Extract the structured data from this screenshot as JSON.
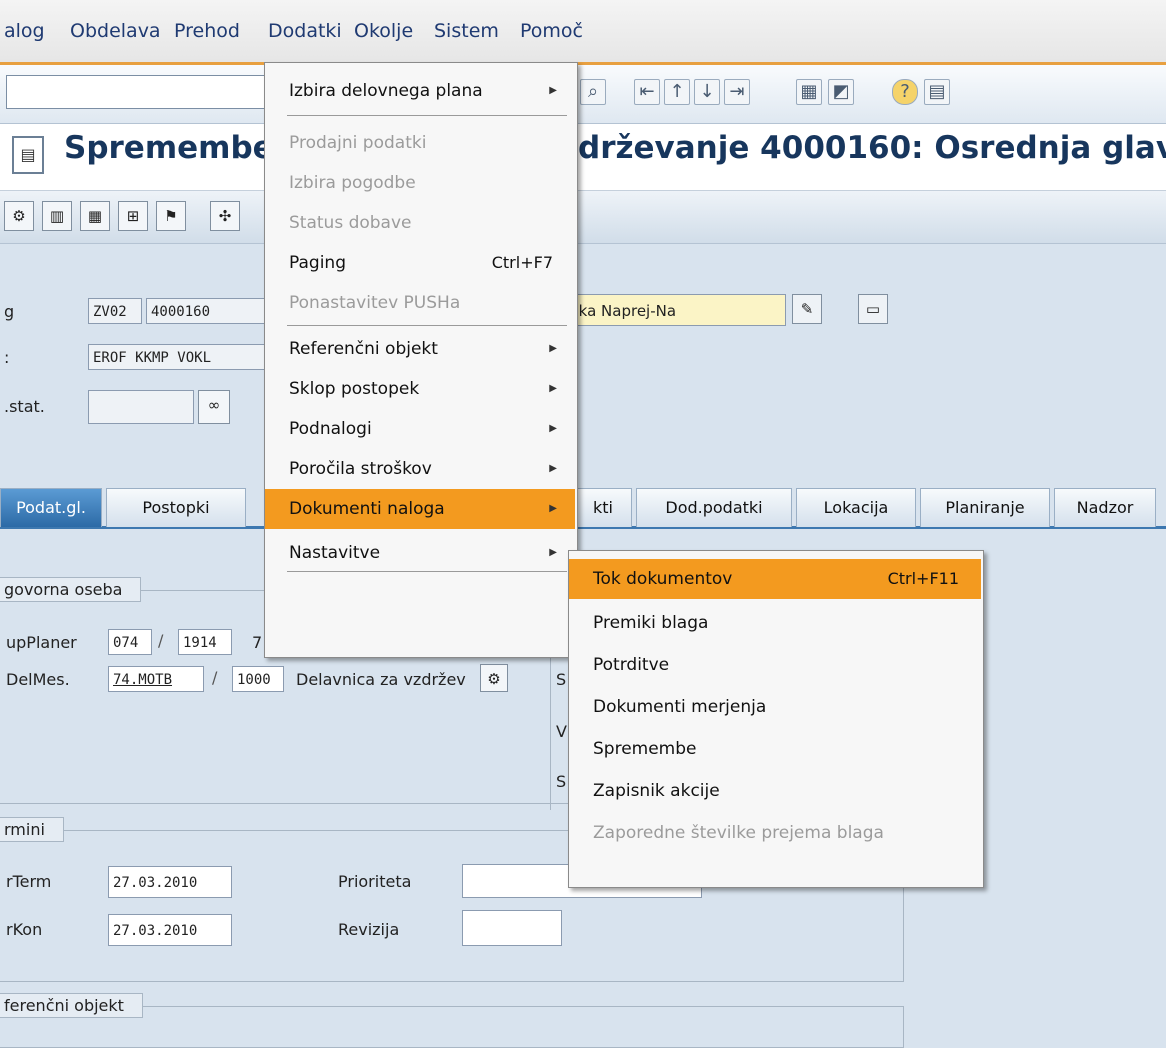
{
  "menubar": {
    "items": [
      "alog",
      "Obdelava",
      "Prehod",
      "Dodatki",
      "Okolje",
      "Sistem",
      "Pomoč"
    ]
  },
  "title": "Spremembe K",
  "title_right": "drževanje 4000160: Osrednja glava",
  "header": {
    "label_order": "g",
    "order_type": "ZV02",
    "order_number": "4000160",
    "label_status": ":",
    "status": "EROF KKMP VOKL",
    "label_user_status": ".stat.",
    "description": "nika Naprej-Na"
  },
  "tabs": [
    "Podat.gl.",
    "Postopki",
    "kti",
    "Dod.podatki",
    "Lokacija",
    "Planiranje",
    "Nadzor"
  ],
  "responsible": {
    "group_title": "govorna oseba",
    "planner_label": "upPlaner",
    "planner_plant": "074",
    "planner_group": "1914",
    "planner_extra": "7",
    "workcenter_label": "DelMes.",
    "workcenter": "74.MOTB",
    "workcenter_plant": "1000",
    "workcenter_desc": "Delavnica za vzdržev",
    "side_letters": [
      "S",
      "V",
      "S"
    ]
  },
  "dates": {
    "group_title": "rmini",
    "start_label": "rTerm",
    "start": "27.03.2010",
    "end_label": "rKon",
    "end": "27.03.2010",
    "priority_label": "Prioriteta",
    "revision_label": "Revizija"
  },
  "reference": {
    "group_title": "ferenčni objekt"
  },
  "dodatki_menu": {
    "items": [
      {
        "label": "Izbira delovnega plana",
        "disabled": false,
        "submenu": true,
        "accel": ""
      },
      {
        "label": "Prodajni podatki",
        "disabled": true,
        "submenu": false,
        "accel": ""
      },
      {
        "label": "Izbira pogodbe",
        "disabled": true,
        "submenu": false,
        "accel": ""
      },
      {
        "label": "Status dobave",
        "disabled": true,
        "submenu": false,
        "accel": ""
      },
      {
        "label": "Paging",
        "disabled": false,
        "submenu": false,
        "accel": "Ctrl+F7"
      },
      {
        "label": "Ponastavitev PUSHa",
        "disabled": true,
        "submenu": false,
        "accel": ""
      },
      {
        "label": "Referenčni objekt",
        "disabled": false,
        "submenu": true,
        "accel": ""
      },
      {
        "label": "Sklop postopek",
        "disabled": false,
        "submenu": true,
        "accel": ""
      },
      {
        "label": "Podnalogi",
        "disabled": false,
        "submenu": true,
        "accel": ""
      },
      {
        "label": "Poročila stroškov",
        "disabled": false,
        "submenu": true,
        "accel": ""
      },
      {
        "label": "Dokumenti naloga",
        "disabled": false,
        "submenu": true,
        "accel": "",
        "highlighted": true
      },
      {
        "label": "Nastavitve",
        "disabled": false,
        "submenu": true,
        "accel": ""
      }
    ]
  },
  "documents_submenu": {
    "items": [
      {
        "label": "Tok dokumentov",
        "accel": "Ctrl+F11",
        "disabled": false,
        "highlighted": true
      },
      {
        "label": "Premiki blaga",
        "accel": "",
        "disabled": false
      },
      {
        "label": "Potrditve",
        "accel": "",
        "disabled": false
      },
      {
        "label": "Dokumenti merjenja",
        "accel": "",
        "disabled": false
      },
      {
        "label": "Spremembe",
        "accel": "",
        "disabled": false
      },
      {
        "label": "Zapisnik akcije",
        "accel": "",
        "disabled": false
      },
      {
        "label": "Zaporedne številke prejema blaga",
        "accel": "",
        "disabled": true
      }
    ]
  },
  "colors": {
    "menu_highlight": "#f39a1f",
    "active_tab": "#3d78b0",
    "title": "#17365d"
  }
}
